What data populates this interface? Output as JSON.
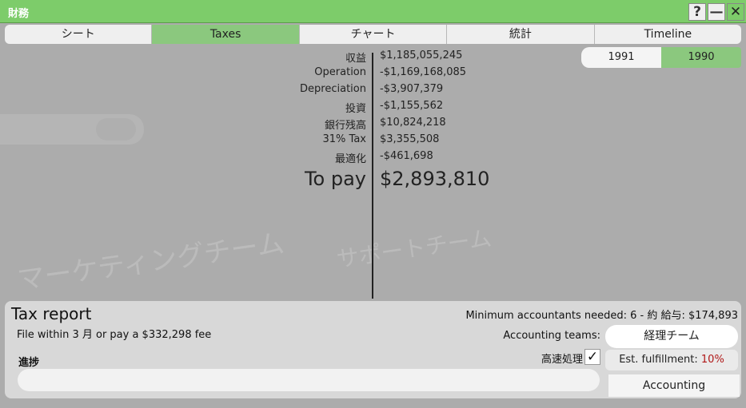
{
  "window": {
    "title": "財務",
    "help_label": "?",
    "minimize_label": "—",
    "close_label": "✕"
  },
  "tabs": [
    {
      "label": "シート",
      "active": false
    },
    {
      "label": "Taxes",
      "active": true
    },
    {
      "label": "チャート",
      "active": false
    },
    {
      "label": "統計",
      "active": false
    },
    {
      "label": "Timeline",
      "active": false
    }
  ],
  "years": [
    {
      "label": "1991",
      "active": false
    },
    {
      "label": "1990",
      "active": true
    }
  ],
  "background_ghost": {
    "line1": "マーケティングチーム",
    "line2": "サポートチーム"
  },
  "tax_rows": [
    {
      "label": "収益",
      "value": "$1,185,055,245"
    },
    {
      "label": "Operation",
      "value": "-$1,169,168,085"
    },
    {
      "label": "Depreciation",
      "value": "-$3,907,379"
    },
    {
      "label": "投資",
      "value": "-$1,155,562"
    },
    {
      "label": "銀行残高",
      "value": "$10,824,218"
    },
    {
      "label": "31% Tax",
      "value": "$3,355,508"
    },
    {
      "label": "最適化",
      "value": "-$461,698"
    }
  ],
  "to_pay": {
    "label": "To pay",
    "value": "$2,893,810"
  },
  "report": {
    "title": "Tax report",
    "subtitle": "File within 3 月 or pay a $332,298 fee",
    "progress_label": "進捗",
    "progress_value": 0,
    "min_accountants": "Minimum accountants needed: 6 - 約 給与: $174,893",
    "teams_label": "Accounting teams:",
    "teams_value": "経理チーム",
    "fast_label": "高速処理",
    "fast_checked": true,
    "check_glyph": "✓",
    "est_label": "Est. fulfillment:",
    "est_value": "10%",
    "accounting_button": "Accounting"
  },
  "colors": {
    "accent_green": "#7dcc6a",
    "active_tab": "#8bc87e",
    "warning_red": "#b01818"
  }
}
